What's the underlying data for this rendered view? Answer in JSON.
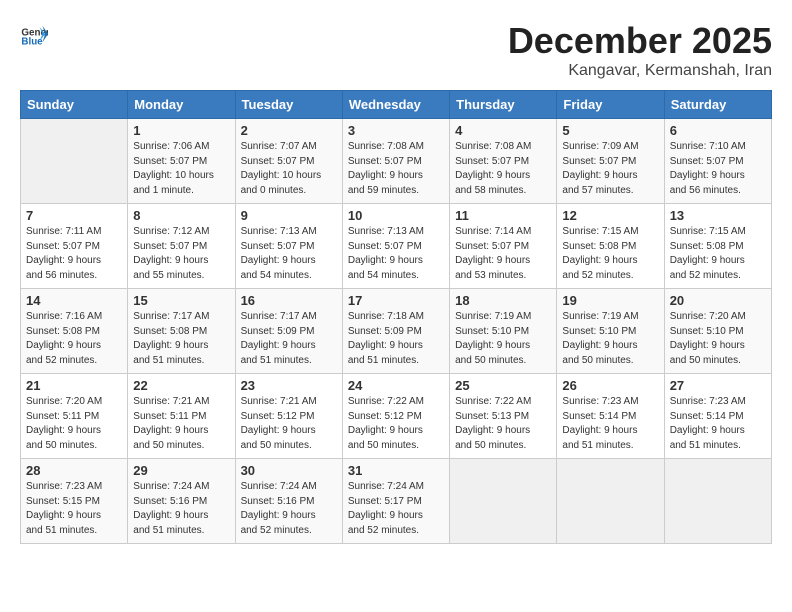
{
  "header": {
    "logo_general": "General",
    "logo_blue": "Blue",
    "month_title": "December 2025",
    "location": "Kangavar, Kermanshah, Iran"
  },
  "weekdays": [
    "Sunday",
    "Monday",
    "Tuesday",
    "Wednesday",
    "Thursday",
    "Friday",
    "Saturday"
  ],
  "weeks": [
    [
      {
        "day": "",
        "info": ""
      },
      {
        "day": "1",
        "info": "Sunrise: 7:06 AM\nSunset: 5:07 PM\nDaylight: 10 hours\nand 1 minute."
      },
      {
        "day": "2",
        "info": "Sunrise: 7:07 AM\nSunset: 5:07 PM\nDaylight: 10 hours\nand 0 minutes."
      },
      {
        "day": "3",
        "info": "Sunrise: 7:08 AM\nSunset: 5:07 PM\nDaylight: 9 hours\nand 59 minutes."
      },
      {
        "day": "4",
        "info": "Sunrise: 7:08 AM\nSunset: 5:07 PM\nDaylight: 9 hours\nand 58 minutes."
      },
      {
        "day": "5",
        "info": "Sunrise: 7:09 AM\nSunset: 5:07 PM\nDaylight: 9 hours\nand 57 minutes."
      },
      {
        "day": "6",
        "info": "Sunrise: 7:10 AM\nSunset: 5:07 PM\nDaylight: 9 hours\nand 56 minutes."
      }
    ],
    [
      {
        "day": "7",
        "info": "Sunrise: 7:11 AM\nSunset: 5:07 PM\nDaylight: 9 hours\nand 56 minutes."
      },
      {
        "day": "8",
        "info": "Sunrise: 7:12 AM\nSunset: 5:07 PM\nDaylight: 9 hours\nand 55 minutes."
      },
      {
        "day": "9",
        "info": "Sunrise: 7:13 AM\nSunset: 5:07 PM\nDaylight: 9 hours\nand 54 minutes."
      },
      {
        "day": "10",
        "info": "Sunrise: 7:13 AM\nSunset: 5:07 PM\nDaylight: 9 hours\nand 54 minutes."
      },
      {
        "day": "11",
        "info": "Sunrise: 7:14 AM\nSunset: 5:07 PM\nDaylight: 9 hours\nand 53 minutes."
      },
      {
        "day": "12",
        "info": "Sunrise: 7:15 AM\nSunset: 5:08 PM\nDaylight: 9 hours\nand 52 minutes."
      },
      {
        "day": "13",
        "info": "Sunrise: 7:15 AM\nSunset: 5:08 PM\nDaylight: 9 hours\nand 52 minutes."
      }
    ],
    [
      {
        "day": "14",
        "info": "Sunrise: 7:16 AM\nSunset: 5:08 PM\nDaylight: 9 hours\nand 52 minutes."
      },
      {
        "day": "15",
        "info": "Sunrise: 7:17 AM\nSunset: 5:08 PM\nDaylight: 9 hours\nand 51 minutes."
      },
      {
        "day": "16",
        "info": "Sunrise: 7:17 AM\nSunset: 5:09 PM\nDaylight: 9 hours\nand 51 minutes."
      },
      {
        "day": "17",
        "info": "Sunrise: 7:18 AM\nSunset: 5:09 PM\nDaylight: 9 hours\nand 51 minutes."
      },
      {
        "day": "18",
        "info": "Sunrise: 7:19 AM\nSunset: 5:10 PM\nDaylight: 9 hours\nand 50 minutes."
      },
      {
        "day": "19",
        "info": "Sunrise: 7:19 AM\nSunset: 5:10 PM\nDaylight: 9 hours\nand 50 minutes."
      },
      {
        "day": "20",
        "info": "Sunrise: 7:20 AM\nSunset: 5:10 PM\nDaylight: 9 hours\nand 50 minutes."
      }
    ],
    [
      {
        "day": "21",
        "info": "Sunrise: 7:20 AM\nSunset: 5:11 PM\nDaylight: 9 hours\nand 50 minutes."
      },
      {
        "day": "22",
        "info": "Sunrise: 7:21 AM\nSunset: 5:11 PM\nDaylight: 9 hours\nand 50 minutes."
      },
      {
        "day": "23",
        "info": "Sunrise: 7:21 AM\nSunset: 5:12 PM\nDaylight: 9 hours\nand 50 minutes."
      },
      {
        "day": "24",
        "info": "Sunrise: 7:22 AM\nSunset: 5:12 PM\nDaylight: 9 hours\nand 50 minutes."
      },
      {
        "day": "25",
        "info": "Sunrise: 7:22 AM\nSunset: 5:13 PM\nDaylight: 9 hours\nand 50 minutes."
      },
      {
        "day": "26",
        "info": "Sunrise: 7:23 AM\nSunset: 5:14 PM\nDaylight: 9 hours\nand 51 minutes."
      },
      {
        "day": "27",
        "info": "Sunrise: 7:23 AM\nSunset: 5:14 PM\nDaylight: 9 hours\nand 51 minutes."
      }
    ],
    [
      {
        "day": "28",
        "info": "Sunrise: 7:23 AM\nSunset: 5:15 PM\nDaylight: 9 hours\nand 51 minutes."
      },
      {
        "day": "29",
        "info": "Sunrise: 7:24 AM\nSunset: 5:16 PM\nDaylight: 9 hours\nand 51 minutes."
      },
      {
        "day": "30",
        "info": "Sunrise: 7:24 AM\nSunset: 5:16 PM\nDaylight: 9 hours\nand 52 minutes."
      },
      {
        "day": "31",
        "info": "Sunrise: 7:24 AM\nSunset: 5:17 PM\nDaylight: 9 hours\nand 52 minutes."
      },
      {
        "day": "",
        "info": ""
      },
      {
        "day": "",
        "info": ""
      },
      {
        "day": "",
        "info": ""
      }
    ]
  ]
}
